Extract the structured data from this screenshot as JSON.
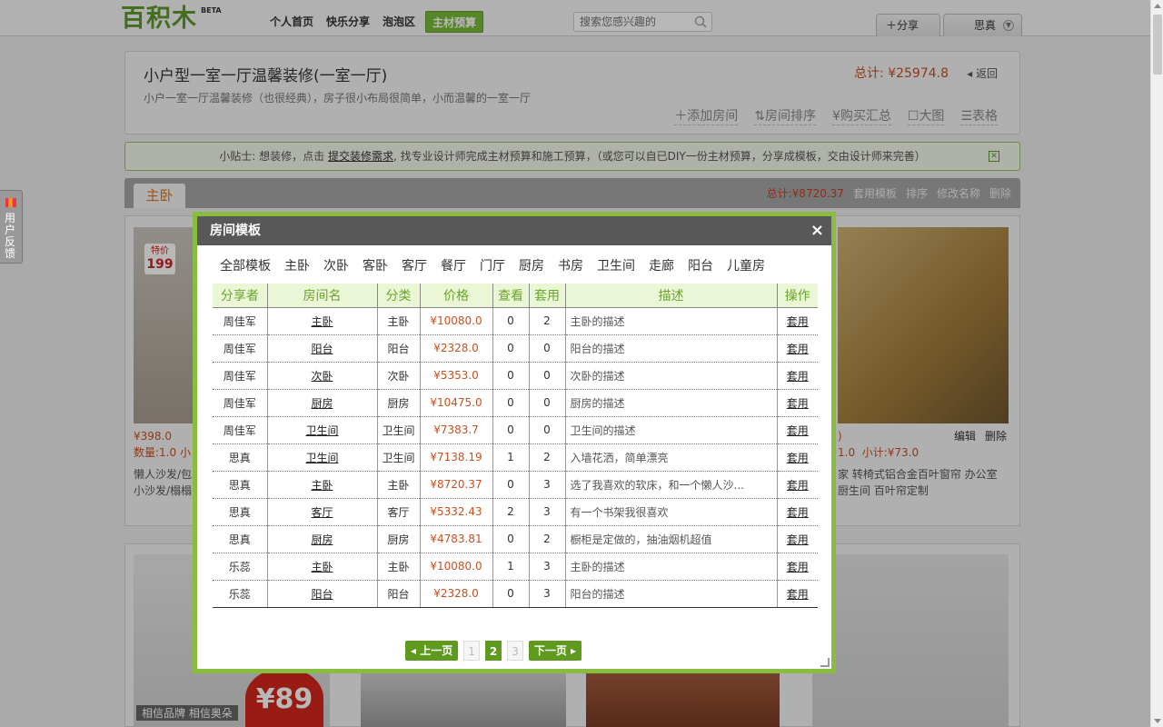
{
  "header": {
    "logo_text": "百积木",
    "beta": "BETA",
    "nav": [
      "个人首页",
      "快乐分享",
      "泡泡区",
      "主材预算"
    ],
    "search_placeholder": "搜索您感兴趣的",
    "share_label": "分享",
    "user_name": "思真"
  },
  "plan": {
    "title": "小户型一室一厅温馨装修(一室一厅)",
    "description": "小户一室一厅温馨装修（也很经典），房子很小布局很简单，小而温馨的一室一厅",
    "total": "总计: ¥25974.8",
    "back": "返回",
    "tools": [
      "添加房间",
      "房间排序",
      "购买汇总",
      "大图",
      "表格"
    ]
  },
  "tip": {
    "prefix": "小贴士: 想装修，点击",
    "link": "提交装修需求",
    "suffix": ", 找专业设计师完成主材预算和施工预算，（或您可以自已DIY一份主材预算，分享成模板，交由设计师来完善）"
  },
  "room": {
    "tab": "主卧",
    "total": "总计:¥8720.37",
    "actions": [
      "套用模板",
      "排序",
      "修改名称",
      "删除"
    ]
  },
  "products": {
    "left_badge_top": "特价",
    "left_badge_price": "199",
    "left_price": "¥398.0",
    "left_qty": "数量:1.0",
    "left_subtotal": "小",
    "left_desc_1": "懒人沙发/包",
    "left_desc_2": "小沙发/榻榻",
    "right_qty": "1.0",
    "right_subtotal": "小计:¥73.0",
    "right_edit": "编辑",
    "right_delete": "删除",
    "right_desc": "家 转椅式铝合金百叶窗帘 办公室 厨生间 百叶帘定制",
    "bottom_badge": "¥89",
    "bottom_caption": "相信品牌 相信奥朵"
  },
  "feedback": "用户反馈",
  "modal": {
    "title": "房间模板",
    "categories": [
      "全部模板",
      "主卧",
      "次卧",
      "客卧",
      "客厅",
      "餐厅",
      "门厅",
      "厨房",
      "书房",
      "卫生间",
      "走廊",
      "阳台",
      "儿童房"
    ],
    "columns": [
      "分享者",
      "房间名",
      "分类",
      "价格",
      "查看",
      "套用",
      "描述",
      "操作"
    ],
    "rows": [
      {
        "sharer": "周佳军",
        "name": "主卧",
        "category": "主卧",
        "price": "¥10080.0",
        "views": "0",
        "uses": "2",
        "desc": "主卧的描述",
        "op": "套用"
      },
      {
        "sharer": "周佳军",
        "name": "阳台",
        "category": "阳台",
        "price": "¥2328.0",
        "views": "0",
        "uses": "0",
        "desc": "阳台的描述",
        "op": "套用"
      },
      {
        "sharer": "周佳军",
        "name": "次卧",
        "category": "次卧",
        "price": "¥5353.0",
        "views": "0",
        "uses": "0",
        "desc": "次卧的描述",
        "op": "套用"
      },
      {
        "sharer": "周佳军",
        "name": "厨房",
        "category": "厨房",
        "price": "¥10475.0",
        "views": "0",
        "uses": "0",
        "desc": "厨房的描述",
        "op": "套用"
      },
      {
        "sharer": "周佳军",
        "name": "卫生间",
        "category": "卫生间",
        "price": "¥7383.7",
        "views": "0",
        "uses": "0",
        "desc": "卫生间的描述",
        "op": "套用"
      },
      {
        "sharer": "思真",
        "name": "卫生间",
        "category": "卫生间",
        "price": "¥7138.19",
        "views": "1",
        "uses": "2",
        "desc": "入墙花洒，简单漂亮",
        "op": "套用"
      },
      {
        "sharer": "思真",
        "name": "主卧",
        "category": "主卧",
        "price": "¥8720.37",
        "views": "0",
        "uses": "3",
        "desc": "选了我喜欢的软床，和一个懒人沙...",
        "op": "套用"
      },
      {
        "sharer": "思真",
        "name": "客厅",
        "category": "客厅",
        "price": "¥5332.43",
        "views": "2",
        "uses": "3",
        "desc": "有一个书架我很喜欢",
        "op": "套用"
      },
      {
        "sharer": "思真",
        "name": "厨房",
        "category": "厨房",
        "price": "¥4783.81",
        "views": "0",
        "uses": "2",
        "desc": "橱柜是定做的，抽油烟机超值",
        "op": "套用"
      },
      {
        "sharer": "乐蕊",
        "name": "主卧",
        "category": "主卧",
        "price": "¥10080.0",
        "views": "1",
        "uses": "3",
        "desc": "主卧的描述",
        "op": "套用"
      },
      {
        "sharer": "乐蕊",
        "name": "阳台",
        "category": "阳台",
        "price": "¥2328.0",
        "views": "0",
        "uses": "3",
        "desc": "阳台的描述",
        "op": "套用"
      }
    ],
    "pager": {
      "prev": "上一页",
      "pages": [
        "1",
        "2",
        "3"
      ],
      "current": "2",
      "next": "下一页"
    }
  },
  "colors": {
    "accent_green": "#89bd3f",
    "price_red": "#c8501f",
    "header_dark": "#585858"
  }
}
